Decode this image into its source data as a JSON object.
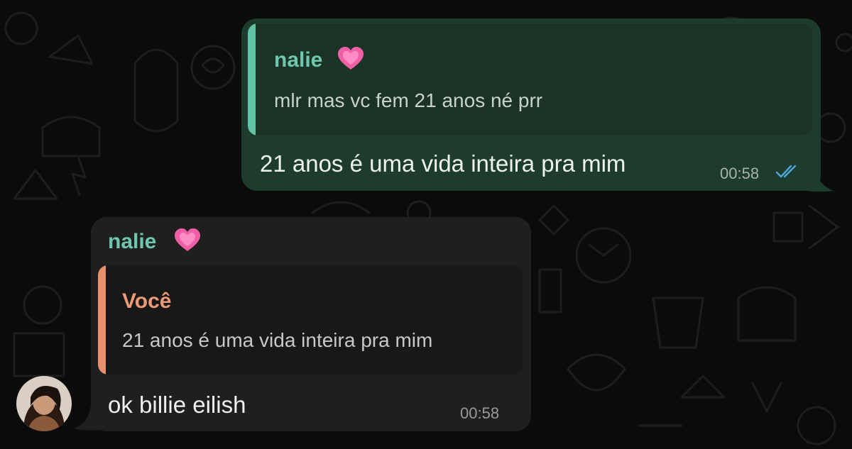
{
  "outgoing": {
    "quote_author": "nalie",
    "quote_text": "mlr mas vc fem 21 anos né prr",
    "message": "21 anos é uma vida inteira pra mim",
    "time": "00:58",
    "status_icon": "double-check-icon"
  },
  "incoming": {
    "sender": "nalie",
    "quote_author": "Você",
    "quote_text": "21 anos é uma vida inteira pra mim",
    "message": "ok billie eilish",
    "time": "00:58",
    "heart_icon": "pink-heart-icon"
  },
  "colors": {
    "background": "#0b0b0b",
    "outgoing_bubble": "#1e3c2d",
    "incoming_bubble": "#1f1f1f",
    "green_accent": "#5fc4a8",
    "orange_accent": "#e8906c",
    "heart": "#ee5fa6"
  }
}
